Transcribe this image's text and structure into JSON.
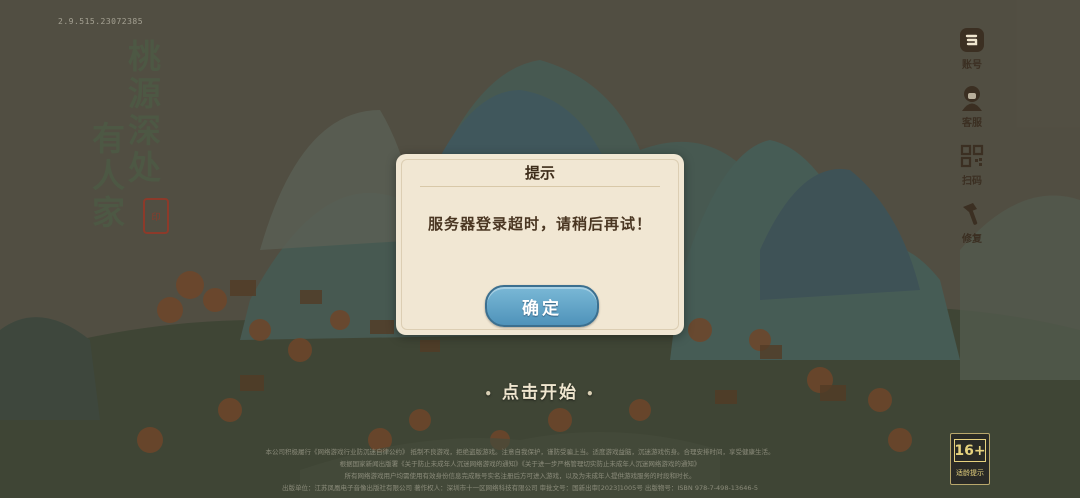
{
  "version": "2.9.515.23072385",
  "logo": {
    "line1": [
      "桃",
      "源",
      "深",
      "处"
    ],
    "line2": [
      "有",
      "人",
      "家"
    ],
    "seal": "印"
  },
  "side_menu": [
    {
      "label": "账号",
      "icon": "account-icon"
    },
    {
      "label": "客服",
      "icon": "customer-service-icon"
    },
    {
      "label": "扫码",
      "icon": "qr-scan-icon"
    },
    {
      "label": "修复",
      "icon": "repair-hammer-icon"
    }
  ],
  "tap_to_start": "点击开始",
  "dialog": {
    "title": "提示",
    "message": "服务器登录超时，请稍后再试！",
    "ok_label": "确定"
  },
  "age_rating": {
    "value": "16+",
    "label": "适龄提示"
  },
  "footer": [
    "本公司积极履行《网络游戏行业防沉迷自律公约》  抵制不良游戏，拒绝盗版游戏。注意自我保护，谨防受骗上当。适度游戏益脑，沉迷游戏伤身。合理安排时间，享受健康生活。",
    "根据国家新闻出版署《关于防止未成年人沉迷网络游戏的通知》《关于进一步严格管理切实防止未成年人沉迷网络游戏的通知》",
    "所有网络游戏用户均需使用有效身份信息完成账号实名注册后方可进入游戏，以及为未成年人提供游戏服务的时段和时长。",
    "出版单位：江苏凤凰电子音像出版社有限公司  著作权人：深圳市十一区网络科技有限公司  审批文号：国新出审[2023]1005号  出版物号：ISBN 978-7-498-13646-5"
  ]
}
